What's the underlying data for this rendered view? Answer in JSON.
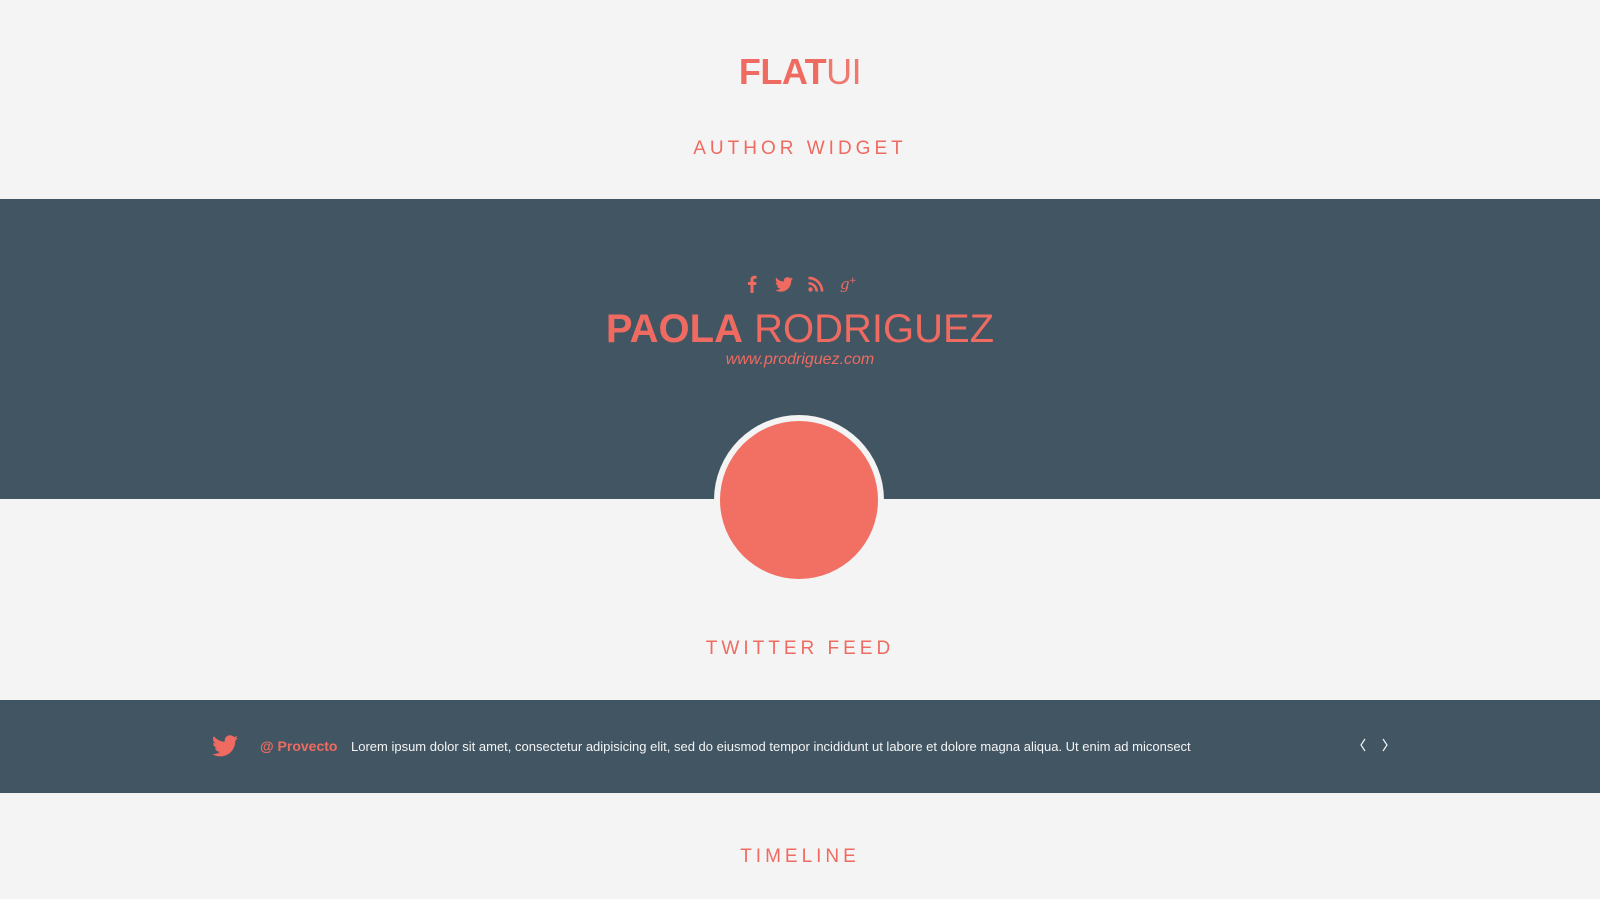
{
  "brand": {
    "bold": "FLAT",
    "light": "UI"
  },
  "sections": {
    "author_widget": "AUTHOR WIDGET",
    "twitter_feed": "TWITTER FEED",
    "timeline": "TIMELINE"
  },
  "author": {
    "first_name": "PAOLA",
    "last_name": "RODRIGUEZ",
    "website": "www.prodriguez.com",
    "socials": [
      "facebook-icon",
      "twitter-icon",
      "rss-icon",
      "google-plus-icon"
    ]
  },
  "twitter": {
    "handle": "@ Provecto",
    "tweet": "Lorem ipsum dolor sit amet, consectetur adipisicing elit, sed do eiusmod tempor incididunt ut labore et dolore magna aliqua. Ut enim ad miconsect",
    "prev_icon": "chevron-left-icon",
    "next_icon": "chevron-right-icon"
  },
  "colors": {
    "accent": "#ef6b61",
    "band": "#415563",
    "background": "#f4f4f4",
    "avatar": "#f26f64"
  }
}
